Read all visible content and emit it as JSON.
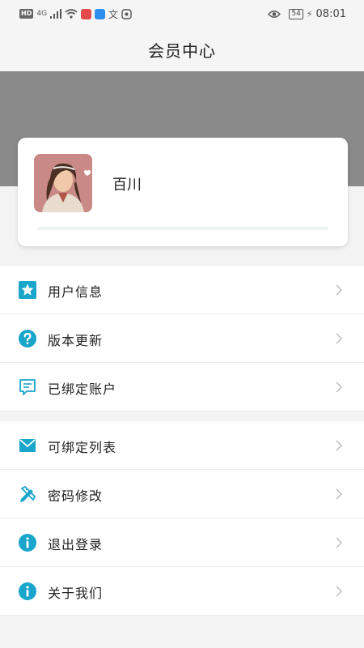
{
  "status_bar": {
    "hd_badge": "HD",
    "network": "4G",
    "battery": "54",
    "time": "08:01",
    "left_icons": [
      "hd-badge-icon",
      "signal-icon",
      "wifi-icon",
      "app-red-icon",
      "app-search-icon",
      "translate-icon",
      "app-misc-icon"
    ],
    "right_icons": [
      "eye-icon",
      "battery-icon",
      "charging-icon"
    ]
  },
  "nav": {
    "title": "会员中心"
  },
  "profile": {
    "name": "百川",
    "avatar_icon": "avatar-image"
  },
  "menu_groups": [
    {
      "items": [
        {
          "label": "用户信息",
          "icon": "star-icon"
        },
        {
          "label": "版本更新",
          "icon": "question-icon"
        },
        {
          "label": "已绑定账户",
          "icon": "message-icon"
        }
      ]
    },
    {
      "items": [
        {
          "label": "可绑定列表",
          "icon": "mail-icon"
        },
        {
          "label": "密码修改",
          "icon": "pencil-ruler-icon"
        },
        {
          "label": "退出登录",
          "icon": "info-icon"
        },
        {
          "label": "关于我们",
          "icon": "info-icon"
        }
      ]
    }
  ],
  "colors": {
    "accent": "#1aa5cb",
    "header_band": "#8a8a8a",
    "background": "#f3f3f3",
    "chevron": "#c4c4c4"
  }
}
